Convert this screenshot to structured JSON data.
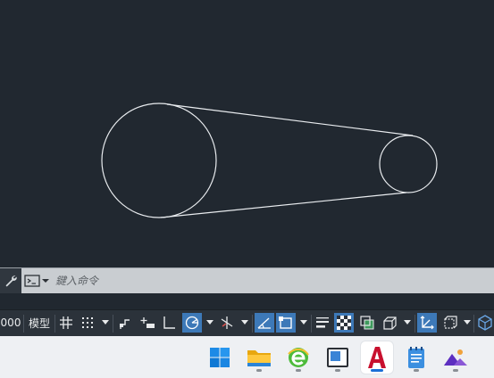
{
  "command_line": {
    "placeholder": "鍵入命令"
  },
  "status_bar": {
    "coord_tail": "000",
    "model_label": "模型"
  },
  "taskbar": {
    "apps": [
      {
        "name": "windows-start",
        "icon": "windows-logo-icon",
        "running": false
      },
      {
        "name": "file-explorer",
        "icon": "folder-icon",
        "running": true
      },
      {
        "name": "browser",
        "icon": "browser-e-icon",
        "running": true
      },
      {
        "name": "window-app",
        "icon": "window-app-icon",
        "running": true
      },
      {
        "name": "autocad",
        "icon": "autocad-a-icon",
        "running": true,
        "active": true
      },
      {
        "name": "notepad",
        "icon": "notepad-icon",
        "running": true
      },
      {
        "name": "photos",
        "icon": "photos-mountain-icon",
        "running": true
      }
    ]
  },
  "colors": {
    "canvas_bg": "#212830",
    "drawing_stroke": "#e9ecef",
    "status_active": "#3d79b8",
    "autocad_red": "#c8102e",
    "accent_blue": "#1a6fd6"
  }
}
